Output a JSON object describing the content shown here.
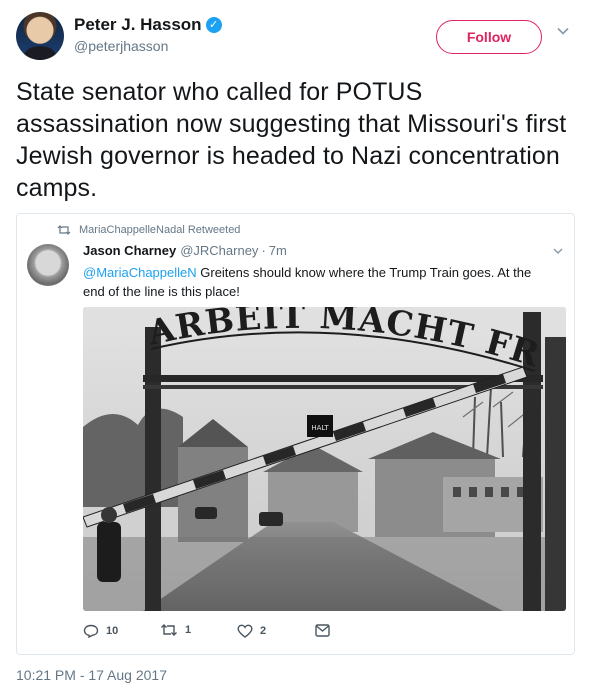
{
  "author": {
    "name": "Peter J. Hasson",
    "verified_glyph": "✓",
    "handle": "@peterjhasson"
  },
  "follow_label": "Follow",
  "tweet_text": "State senator who called for POTUS assassination now suggesting that Missouri's first Jewish governor is headed to Nazi concentration camps.",
  "quoted": {
    "retweeted_by": "MariaChappelleNadal Retweeted",
    "name": "Jason Charney",
    "handle": "@JRCharney",
    "separator": "·",
    "time": "7m",
    "mention": "@MariaChappelleN",
    "text": " Greitens should know where the Trump Train goes. At the end of the line is this place!",
    "image_gate_text": "ARBEIT MACHT FREI",
    "image_sign_text": "HALT",
    "actions": {
      "replies": "10",
      "retweets": "1",
      "likes": "2"
    }
  },
  "timestamp": "10:21 PM - 17 Aug 2017",
  "icons": [
    "verified-badge-icon",
    "chevron-down-icon",
    "retweet-icon",
    "reply-icon",
    "like-icon",
    "message-icon"
  ],
  "colors": {
    "follow": "#e0245e",
    "link": "#1da1f2",
    "muted": "#657786",
    "verified": "#1da1f2"
  }
}
